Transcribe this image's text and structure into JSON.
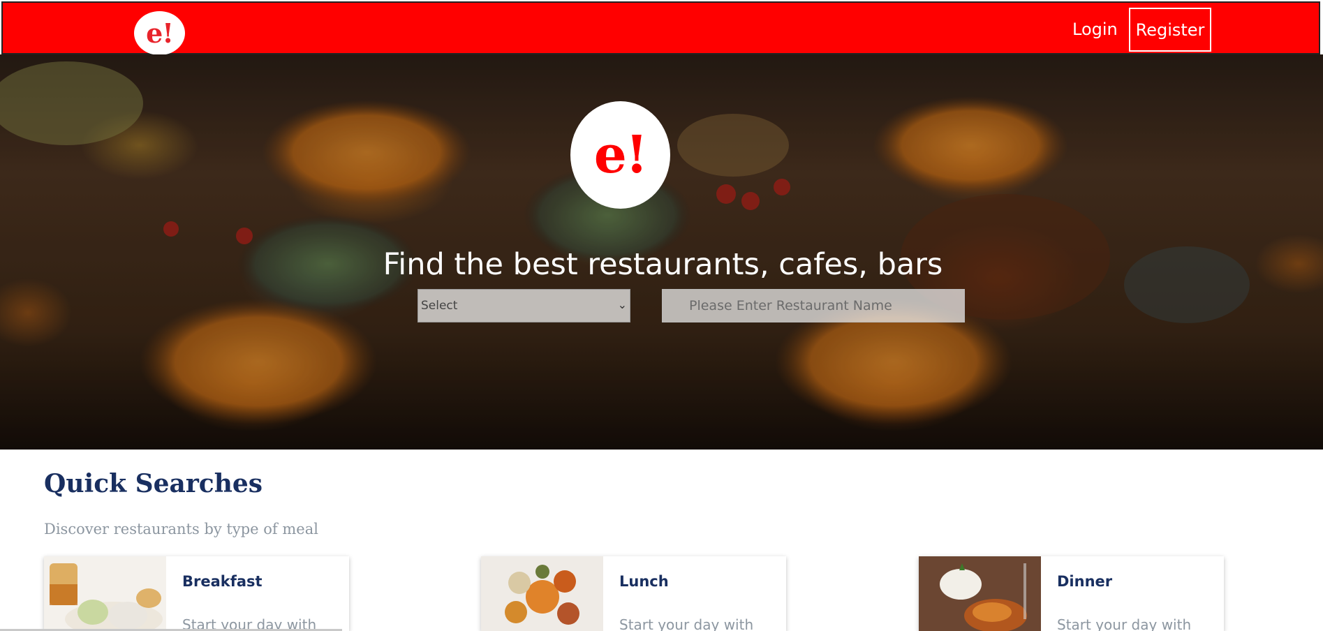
{
  "header": {
    "logo_text": "e!",
    "login_label": "Login",
    "register_label": "Register"
  },
  "hero": {
    "logo_text": "e!",
    "title": "Find the best restaurants, cafes, bars",
    "location_select_value": "Select",
    "restaurant_search_placeholder": "Please Enter Restaurant Name"
  },
  "quick_searches": {
    "title": "Quick Searches",
    "subtitle": "Discover restaurants by type of meal",
    "cards": [
      {
        "title": "Breakfast",
        "description": "Start your day with"
      },
      {
        "title": "Lunch",
        "description": "Start your day with"
      },
      {
        "title": "Dinner",
        "description": "Start your day with"
      }
    ]
  },
  "colors": {
    "brand_red": "#ff0000",
    "heading_navy": "#192f60",
    "muted_text": "#8c96a0"
  }
}
